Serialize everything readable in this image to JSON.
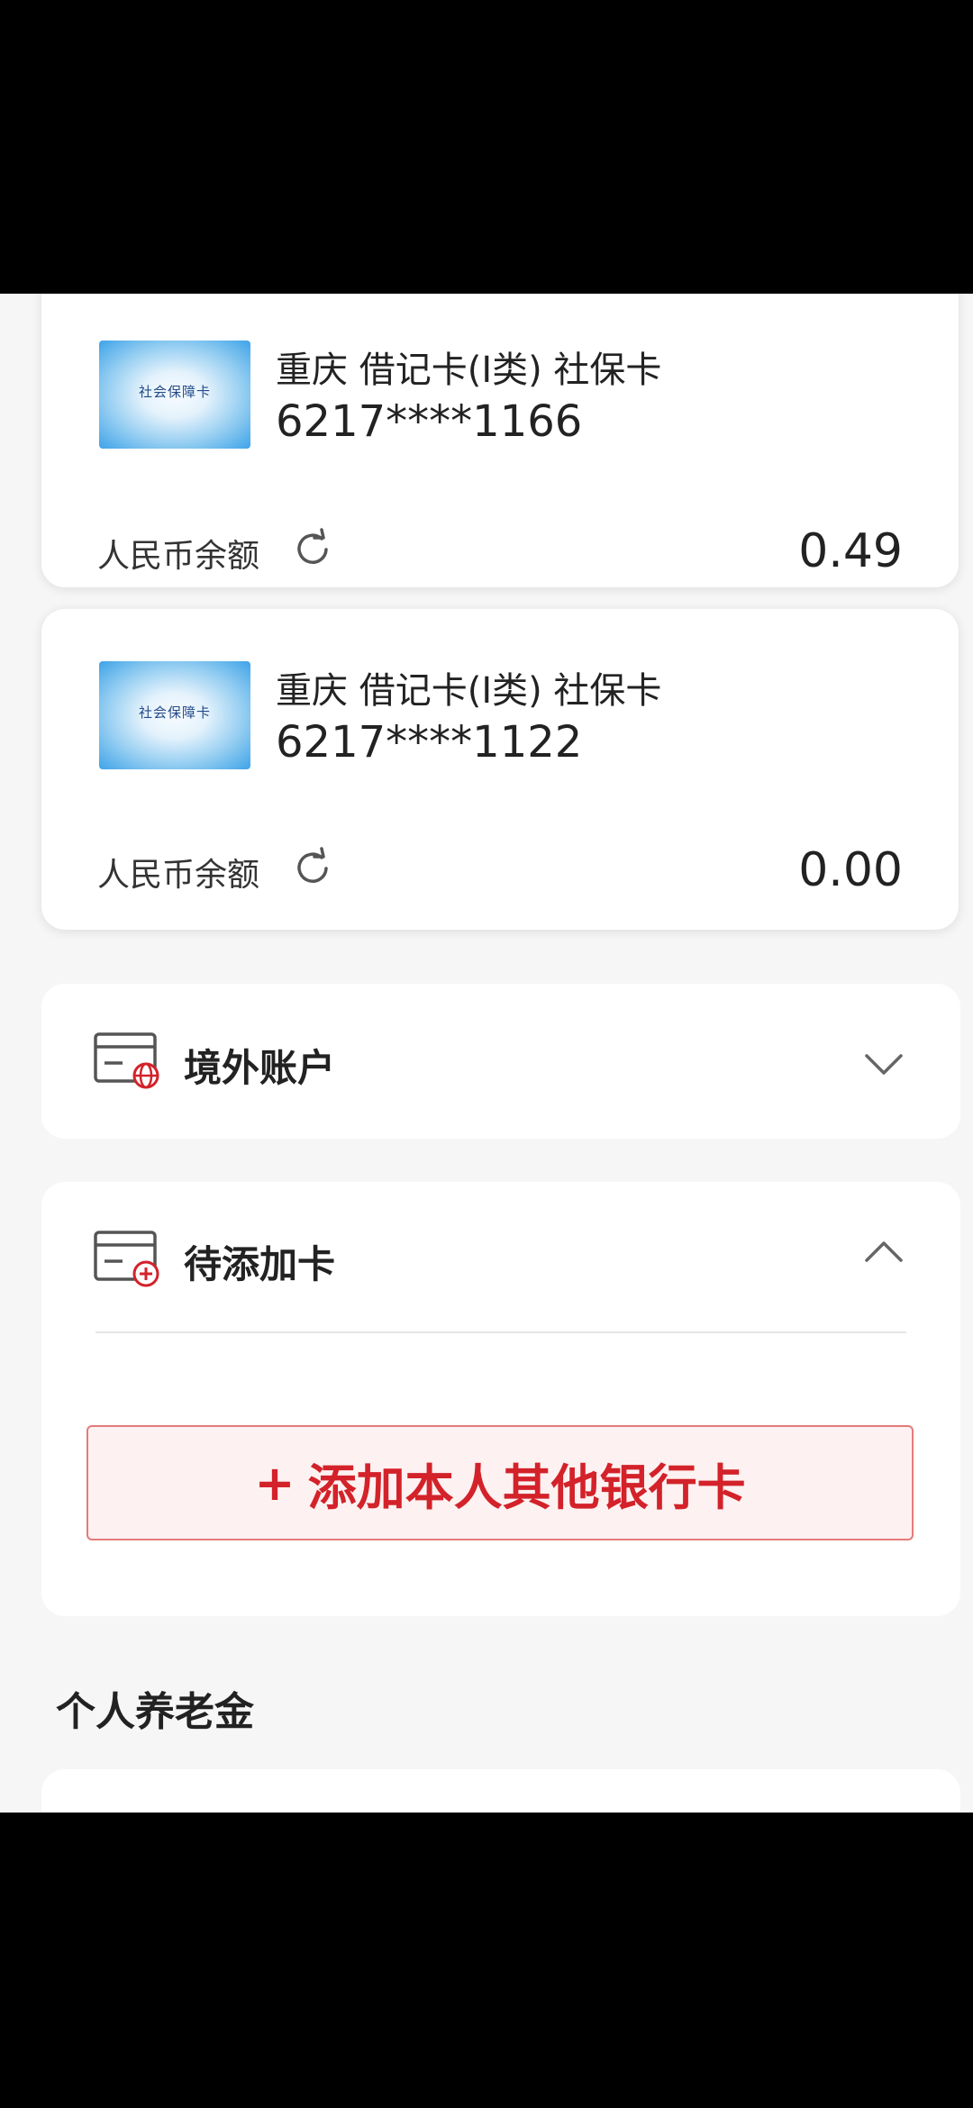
{
  "cards": [
    {
      "thumb_text": "社会保障卡",
      "title": "重庆 借记卡(I类) 社保卡",
      "number": "6217****1166",
      "balance_label": "人民币余额",
      "balance": "0.49"
    },
    {
      "thumb_text": "社会保障卡",
      "title": "重庆 借记卡(I类) 社保卡",
      "number": "6217****1122",
      "balance_label": "人民币余额",
      "balance": "0.00"
    }
  ],
  "overseas": {
    "title": "境外账户",
    "icon": "card-globe-icon",
    "expanded": false
  },
  "pending": {
    "title": "待添加卡",
    "icon": "card-add-icon",
    "expanded": true,
    "add_plus": "+",
    "add_label": "添加本人其他银行卡"
  },
  "pension": {
    "title": "个人养老金"
  },
  "colors": {
    "accent": "#d3222a",
    "add_bg": "#fdf1f1",
    "add_border": "#e57a7a",
    "page_bg": "#f6f6f6"
  }
}
